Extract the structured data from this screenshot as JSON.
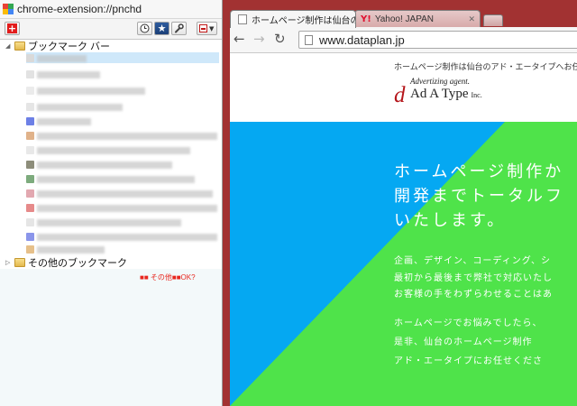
{
  "extension_window": {
    "title": "chrome-extension://pnchd",
    "toolbar": {
      "add_icon": "plus-icon",
      "history_icon": "clock-icon",
      "star_icon": "star-icon",
      "wrench_icon": "wrench-icon",
      "menu_icon": "menu-dropdown-icon"
    },
    "tree": {
      "bookmark_bar_label": "ブックマーク バー",
      "other_bookmarks_label": "その他のブックマーク"
    },
    "status_text": "■■ その他■■OK?"
  },
  "browser": {
    "tabs": [
      {
        "label": "ホームページ制作は仙台のア",
        "active": true
      },
      {
        "label": "Yahoo! JAPAN",
        "active": false
      }
    ],
    "url": "www.dataplan.jp",
    "page": {
      "tagline": "ホームページ制作は仙台のアド・エータイプへお任せ",
      "logo_top": "Advertizing agent.",
      "logo_main": "Ad A Type",
      "logo_inc": "Inc.",
      "hero_heading_lines": [
        "ホームページ制作か",
        "開発までトータルフ",
        "いたします。"
      ],
      "hero_body_lines": [
        "企画、デザイン、コーディング、シ",
        "最初から最後まで弊社で対応いたし",
        "お客様の手をわずらわせることはあ"
      ],
      "hero_body2_lines": [
        "ホームページでお悩みでしたら、",
        "是非、仙台のホームページ制作",
        "アド・エータイプにお任せくださ"
      ]
    },
    "colors": {
      "frame": "#a23232",
      "hero_blue": "#05a8f2",
      "hero_green": "#4fe34a",
      "logo_red": "#b5161b"
    }
  }
}
